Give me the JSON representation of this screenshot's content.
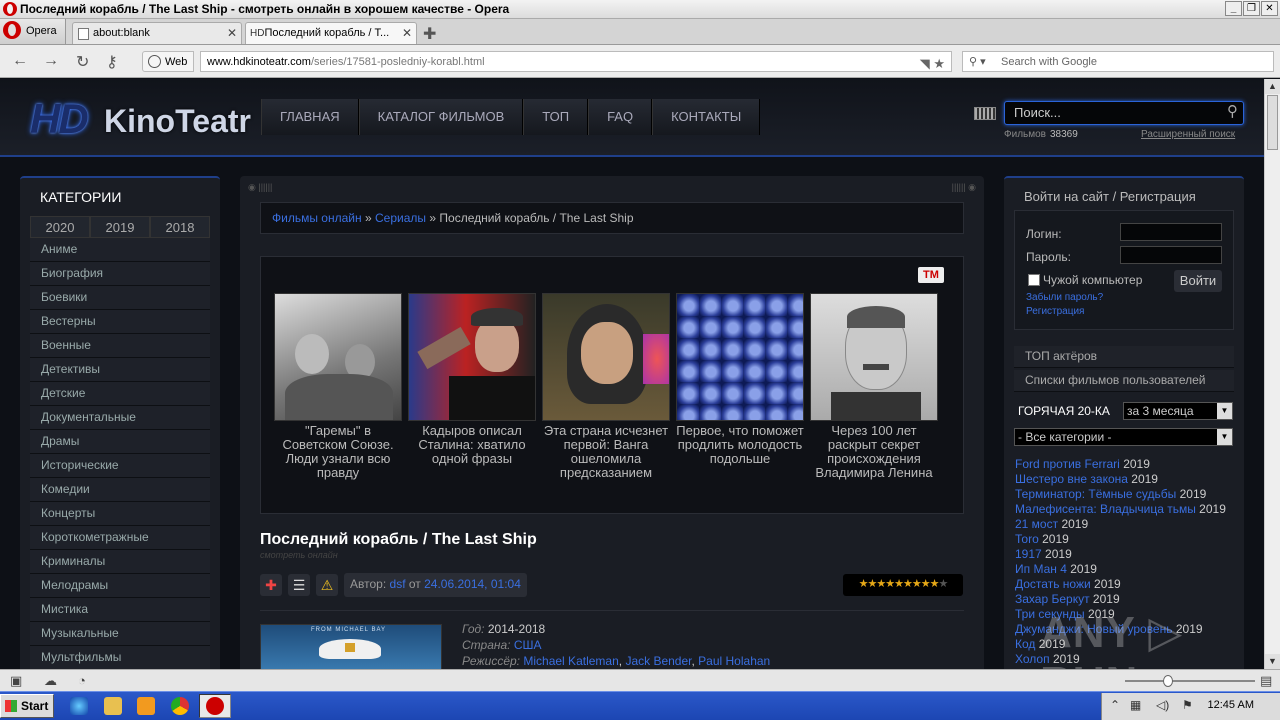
{
  "window": {
    "title": "Последний корабль / The Last Ship - смотреть онлайн в хорошем качестве - Opera"
  },
  "browser": {
    "menu_label": "Opera",
    "tabs": [
      {
        "label": "about:blank"
      },
      {
        "label": "Последний корабль / T..."
      }
    ],
    "tab2_favicon": "HD",
    "web_badge": "Web",
    "url_host": "www.hdkinoteatr.com",
    "url_path": "/series/17581-posledniy-korabl.html",
    "search_placeholder": "Search with Google"
  },
  "site": {
    "logo_hd": "HD",
    "logo_name": "KinoTeatr",
    "nav": [
      "ГЛАВНАЯ",
      "КАТАЛОГ ФИЛЬМОВ",
      "ТОП",
      "FAQ",
      "КОНТАКТЫ"
    ],
    "search_placeholder": "Поиск...",
    "films_label": "Фильмов",
    "films_count": "38369",
    "advanced_search": "Расширенный поиск"
  },
  "left": {
    "title": "КАТЕГОРИИ",
    "years": [
      "2020",
      "2019",
      "2018"
    ],
    "categories": [
      "Аниме",
      "Биография",
      "Боевики",
      "Вестерны",
      "Военные",
      "Детективы",
      "Детские",
      "Документальные",
      "Драмы",
      "Исторические",
      "Комедии",
      "Концерты",
      "Короткометражные",
      "Криминалы",
      "Мелодрамы",
      "Мистика",
      "Музыкальные",
      "Мультфильмы"
    ]
  },
  "center": {
    "breadcrumb": {
      "crumb1": "Фильмы онлайн",
      "sep": "»",
      "crumb2": "Сериалы",
      "current": "Последний корабль / The Last Ship"
    },
    "news_logo": "TM",
    "news": [
      {
        "caption": "\"Гаремы\" в Советском Союзе. Люди узнали всю правду"
      },
      {
        "caption": "Кадыров описал Сталина: хватило одной фразы"
      },
      {
        "caption": "Эта страна исчезнет первой: Ванга ошеломила предсказанием"
      },
      {
        "caption": "Первое, что поможет продлить молодость подольше"
      },
      {
        "caption": "Через 100 лет раскрыт секрет происхождения Владимира Ленина"
      }
    ],
    "movie_title": "Последний корабль / The Last Ship",
    "movie_subtitle": "смотреть онлайн",
    "author_label": "Автор:",
    "author": "dsf",
    "from_label": "от",
    "date": "24.06.2014, 01:04",
    "rating": {
      "value": 9,
      "max": 10
    },
    "poster_text": "FROM MICHAEL BAY",
    "meta": {
      "year_label": "Год:",
      "year": "2014-2018",
      "country_label": "Страна:",
      "country": "США",
      "director_label": "Режиссёр:",
      "directors": [
        "Michael Katleman",
        "Jack Bender",
        "Paul Holahan"
      ]
    }
  },
  "right": {
    "login_title": "Войти на сайт / Регистрация",
    "login_label": "Логин:",
    "password_label": "Пароль:",
    "remember_label": "Чужой компьютер",
    "login_button": "Войти",
    "forgot": "Забыли пароль?",
    "register": "Регистрация",
    "top_actors": "ТОП актёров",
    "user_lists": "Списки фильмов пользователей",
    "hot_title": "ГОРЯЧАЯ 20-КА",
    "period": "за 3 месяца",
    "all_categories": "- Все категории -",
    "hot": [
      {
        "title": "Ford против Ferrari",
        "year": "2019"
      },
      {
        "title": "Шестеро вне закона",
        "year": "2019"
      },
      {
        "title": "Терминатор: Тёмные судьбы",
        "year": "2019"
      },
      {
        "title": "Малефисента: Владычица тьмы",
        "year": "2019"
      },
      {
        "title": "21 мост",
        "year": "2019"
      },
      {
        "title": "Тоrо",
        "year": "2019"
      },
      {
        "title": "1917",
        "year": "2019"
      },
      {
        "title": "Ип Ман 4",
        "year": "2019"
      },
      {
        "title": "Достать ножи",
        "year": "2019"
      },
      {
        "title": "Захар Беркут",
        "year": "2019"
      },
      {
        "title": "Три секунды",
        "year": "2019"
      },
      {
        "title": "Джуманджи: Новый уровень",
        "year": "2019"
      },
      {
        "title": "Код",
        "year": "2019"
      },
      {
        "title": "Холоп",
        "year": "2019"
      }
    ]
  },
  "watermark": "ANY ▷ RUN",
  "taskbar": {
    "start": "Start",
    "clock": "12:45 AM"
  }
}
